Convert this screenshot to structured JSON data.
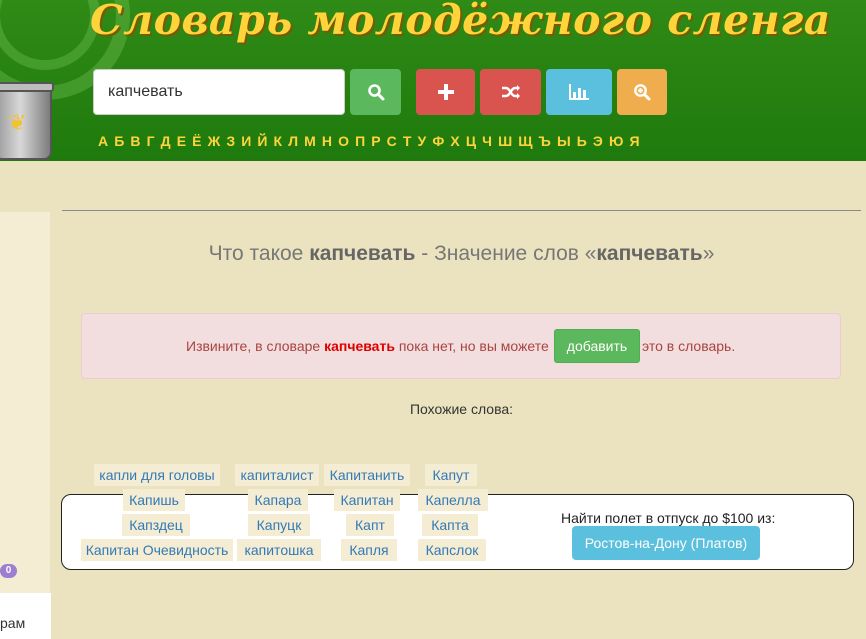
{
  "header": {
    "title": "Словарь молодёжного сленга",
    "search": {
      "value": "капчевать",
      "placeholder": ""
    },
    "buttons": {
      "search_icon": "search-icon",
      "add_icon": "plus-icon",
      "random_icon": "shuffle-icon",
      "stats_icon": "bar-chart-icon",
      "zoom_icon": "zoom-in-icon"
    },
    "alphabet": [
      "А",
      "Б",
      "В",
      "Г",
      "Д",
      "Е",
      "Ё",
      "Ж",
      "З",
      "И",
      "Й",
      "К",
      "Л",
      "М",
      "Н",
      "О",
      "П",
      "Р",
      "С",
      "Т",
      "У",
      "Ф",
      "Х",
      "Ц",
      "Ч",
      "Ш",
      "Щ",
      "Ъ",
      "Ы",
      "Ь",
      "Э",
      "Ю",
      "Я"
    ]
  },
  "main": {
    "title_prefix": "Что такое ",
    "title_word1": "капчевать",
    "title_middle": " - Значение слов «",
    "title_word2": "капчевать",
    "title_suffix": "»",
    "alert": {
      "before": "Извините, в словаре ",
      "word": "капчевать",
      "after": " пока нет, но вы можете",
      "button": "добавить",
      "tail": "это в словарь."
    },
    "similar_title": "Похожие слова:",
    "similar_words": [
      "капли для головы",
      "капиталист",
      "Капитанить",
      "Капут",
      "Капишь",
      "Капара",
      "Капитан",
      "Капелла",
      "Капздец",
      "Капуцк",
      "Капт",
      "Капта",
      "Капитан Очевидность",
      "капитошка",
      "Капля",
      "Капслок"
    ]
  },
  "ad": {
    "text": "Найти полет в отпуск до $100 из:",
    "button": "Ростов-на-Дону (Платов)"
  },
  "sidebar": {
    "badge": "0",
    "panel_text": "рам"
  },
  "colors": {
    "header_green": "#2f8a16",
    "title_yellow": "#ffd43a",
    "page_bg": "#ebe3bf",
    "link_blue": "#337ab7"
  }
}
